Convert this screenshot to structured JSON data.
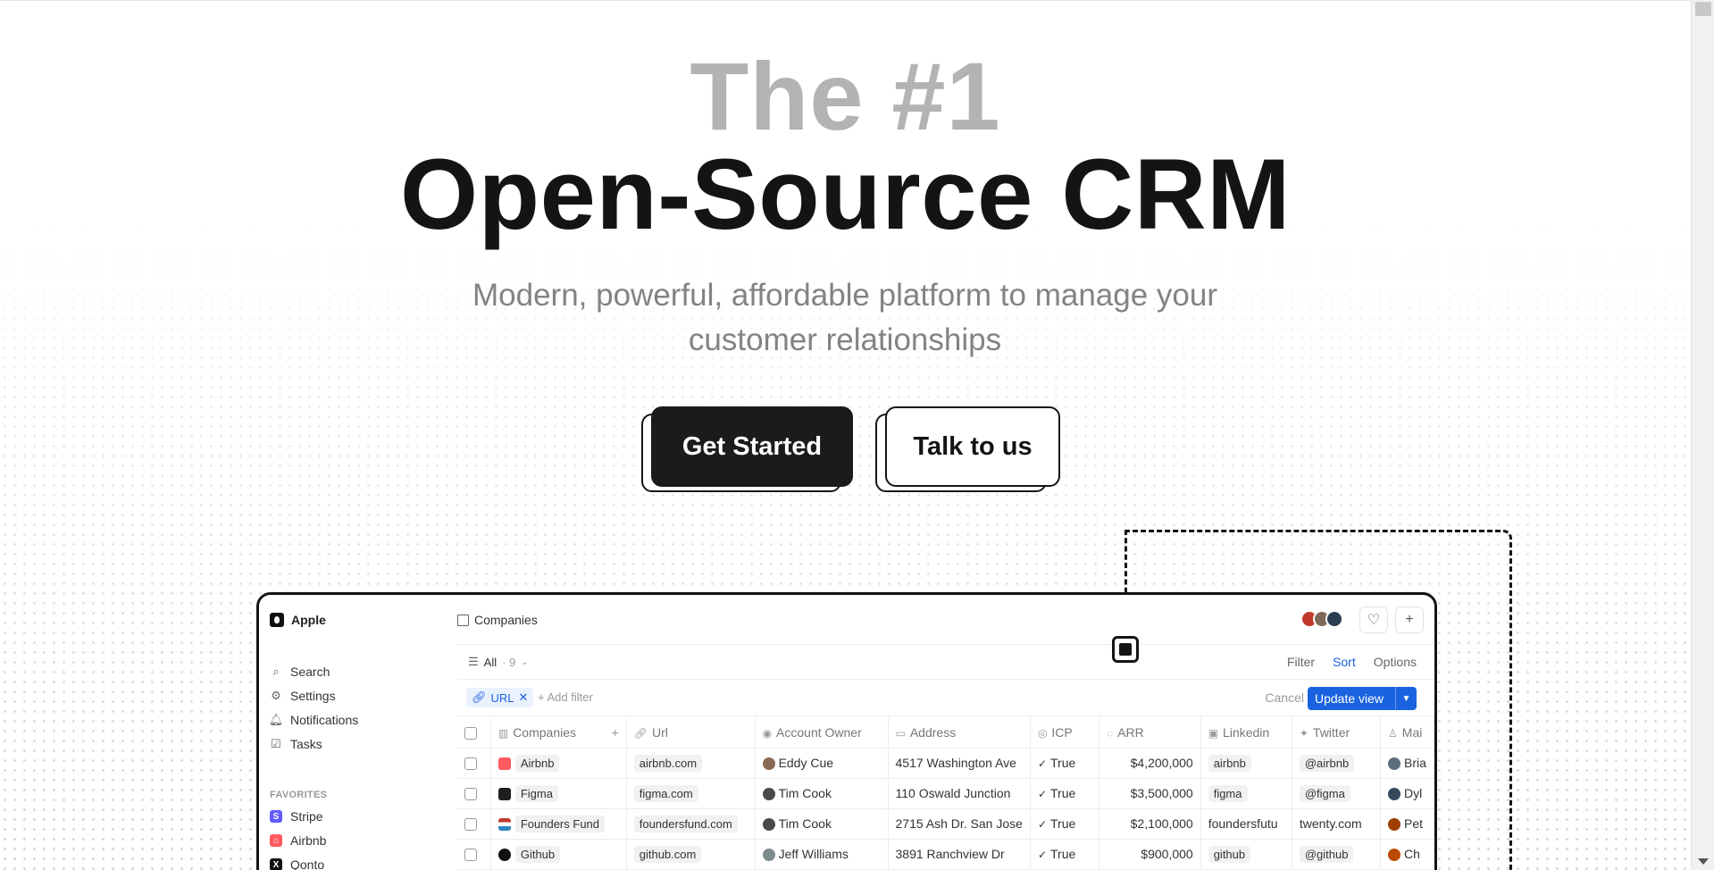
{
  "hero": {
    "title_line1": "The #1",
    "title_line2": "Open-Source CRM",
    "subtitle": "Modern, powerful, affordable platform to manage your customer relationships",
    "primary_cta": "Get Started",
    "secondary_cta": "Talk to us"
  },
  "app": {
    "workspace": "Apple",
    "nav": [
      {
        "label": "Search",
        "icon": "search-icon"
      },
      {
        "label": "Settings",
        "icon": "gear-icon"
      },
      {
        "label": "Notifications",
        "icon": "bell-icon"
      },
      {
        "label": "Tasks",
        "icon": "checkbox-icon"
      }
    ],
    "favorites_title": "FAVORITES",
    "favorites": [
      {
        "label": "Stripe",
        "color": "#635bff",
        "glyph": "S"
      },
      {
        "label": "Airbnb",
        "color": "#ff5a5f",
        "glyph": "⌂"
      },
      {
        "label": "Qonto",
        "color": "#111111",
        "glyph": "X"
      }
    ],
    "breadcrumb": "Companies",
    "view": {
      "label": "All",
      "count": "· 9"
    },
    "view_actions": {
      "filter": "Filter",
      "sort": "Sort",
      "options": "Options"
    },
    "filter_chip": "URL",
    "add_filter": "+ Add filter",
    "cancel": "Cancel",
    "update_view": "Update view",
    "columns": [
      "Companies",
      "Url",
      "Account Owner",
      "Address",
      "ICP",
      "ARR",
      "Linkedin",
      "Twitter",
      "Mai"
    ],
    "rows": [
      {
        "company": "Airbnb",
        "logo_color": "#ff5a5f",
        "url": "airbnb.com",
        "owner": "Eddy Cue",
        "address": "4517 Washington Ave",
        "icp": "True",
        "arr": "$4,200,000",
        "linkedin": "airbnb",
        "twitter": "@airbnb",
        "main": "Bria"
      },
      {
        "company": "Figma",
        "logo_color": "#1e1e1e",
        "url": "figma.com",
        "owner": "Tim Cook",
        "address": "110 Oswald Junction",
        "icp": "True",
        "arr": "$3,500,000",
        "linkedin": "figma",
        "twitter": "@figma",
        "main": "Dyl"
      },
      {
        "company": "Founders Fund",
        "logo_color": "#c0392b",
        "url": "foundersfund.com",
        "owner": "Tim Cook",
        "address": "2715 Ash Dr. San Jose",
        "icp": "True",
        "arr": "$2,100,000",
        "linkedin": "foundersfutu",
        "twitter": "twenty.com",
        "main": "Pet"
      },
      {
        "company": "Github",
        "logo_color": "#111111",
        "url": "github.com",
        "owner": "Jeff Williams",
        "address": "3891 Ranchview Dr",
        "icp": "True",
        "arr": "$900,000",
        "linkedin": "github",
        "twitter": "@github",
        "main": "Ch"
      }
    ]
  }
}
